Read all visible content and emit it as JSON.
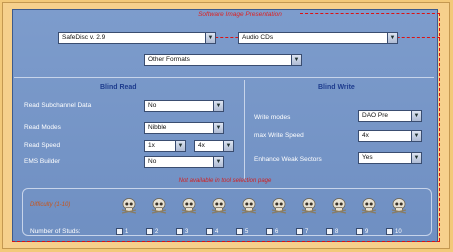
{
  "header_note": "Software Image Presentation",
  "top_dropdowns": {
    "software": {
      "value": "SafeDisc v. 2.9"
    },
    "media": {
      "value": "Audio CDs"
    },
    "formats": {
      "value": "Other Formats"
    }
  },
  "blind_read": {
    "title": "Blind Read",
    "rows": [
      {
        "label": "Read Subchannel Data",
        "value": "No"
      },
      {
        "label": "Read Modes",
        "value": "Nibble"
      },
      {
        "label": "Read Speed",
        "value": "1x",
        "value2": "4x"
      },
      {
        "label": "EMS Builder",
        "value": "No"
      }
    ]
  },
  "blind_write": {
    "title": "Blind Write",
    "rows": [
      {
        "label": "Write modes",
        "value": "DAO Pre"
      },
      {
        "label": "max Write Speed",
        "value": "4x"
      },
      {
        "label": "Enhance Weak Sectors",
        "value": "Yes"
      }
    ]
  },
  "sub_note": "Not available in tool selection page",
  "difficulty": {
    "label": "Difficulty (1-10)",
    "level": 10,
    "max": 10
  },
  "studs": {
    "label": "Number of Studs:",
    "options": [
      "1",
      "2",
      "3",
      "4",
      "5",
      "6",
      "7",
      "8",
      "9",
      "10"
    ]
  },
  "colors": {
    "background": "#f3c979",
    "panel": "#7592c5",
    "accent_red": "#d11111",
    "title_blue": "#1d3c8e"
  }
}
